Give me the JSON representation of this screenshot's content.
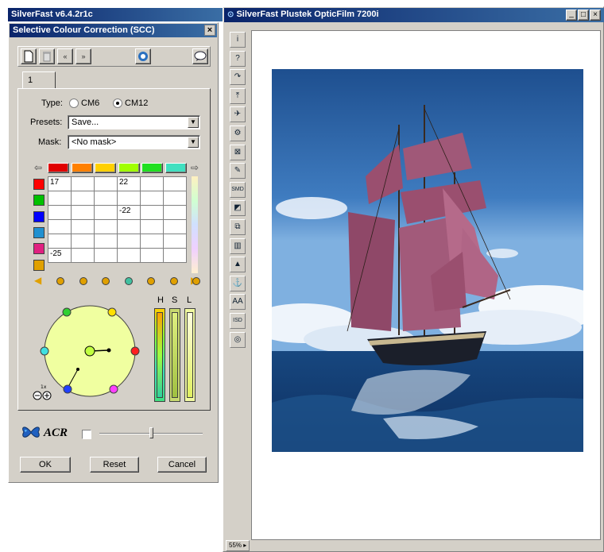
{
  "left_app": {
    "title": "SilverFast v6.4.2r1c"
  },
  "scc": {
    "title": "Selective Colour Correction (SCC)",
    "close_glyph": "×",
    "tab_label": "1",
    "type_label": "Type:",
    "type_options": [
      "CM6",
      "CM12"
    ],
    "type_selected": "CM12",
    "presets_label": "Presets:",
    "presets_value": "Save...",
    "mask_label": "Mask:",
    "mask_value": "<No mask>",
    "row_colors": [
      "#ff0000",
      "#00c000",
      "#0000ff",
      "#2090d0",
      "#e02080",
      "#e0a000"
    ],
    "col_colors": [
      "#e00000",
      "#ff8000",
      "#ffd000",
      "#a0ff00",
      "#20e020",
      "#40e0c0"
    ],
    "grid_values": [
      [
        "17",
        "",
        "",
        "22",
        "",
        ""
      ],
      [
        "",
        "",
        "",
        "",
        "",
        ""
      ],
      [
        "",
        "",
        "",
        "-22",
        "",
        ""
      ],
      [
        "",
        "",
        "",
        "",
        "",
        ""
      ],
      [
        "",
        "",
        "",
        "",
        "",
        ""
      ],
      [
        "-25",
        "",
        "",
        "",
        "",
        ""
      ]
    ],
    "hsl_labels": [
      "H",
      "S",
      "L"
    ],
    "acr_label": "ACR",
    "ok_label": "OK",
    "reset_label": "Reset",
    "cancel_label": "Cancel"
  },
  "preview": {
    "title": "SilverFast Plustek OpticFilm 7200i",
    "zoom": "55%",
    "window_controls": [
      "_",
      "□",
      "×"
    ],
    "tools": [
      "i",
      "?",
      "↷",
      "⤒",
      "✈",
      "⚙",
      "⊠",
      "✎",
      "SMD",
      "◩",
      "⧉",
      "▥",
      "▲",
      "⚓",
      "AA",
      "ISD",
      "◎"
    ]
  }
}
